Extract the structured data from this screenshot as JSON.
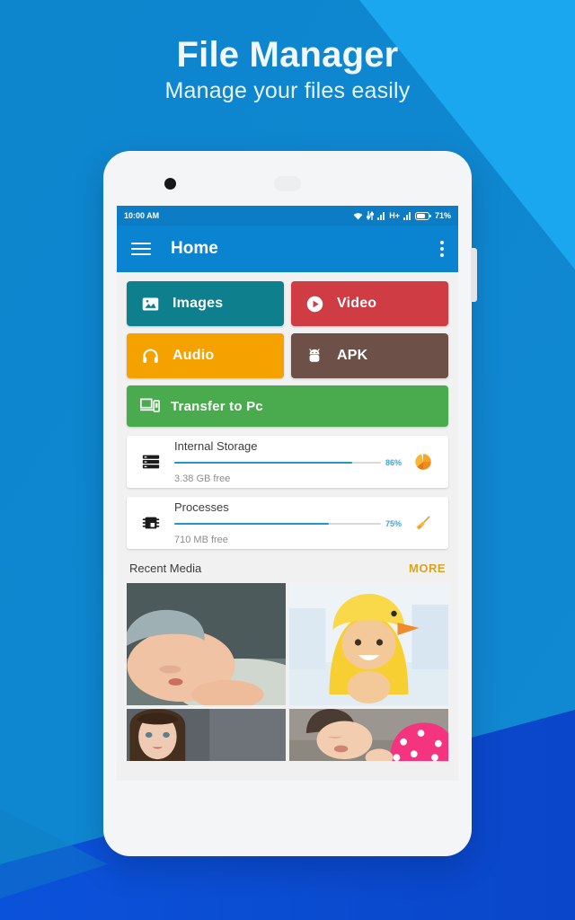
{
  "hero": {
    "title": "File Manager",
    "subtitle": "Manage your files easily"
  },
  "colors": {
    "bg_primary": "#0d85cd",
    "bg_light_wedge": "#1aa7f0",
    "bg_deep_blue": "#0a4ed6",
    "appbar": "#0a84d0",
    "statusbar": "#0c7dc4",
    "accent_more": "#d9a520",
    "progress": "#2196c9"
  },
  "phone": {
    "statusbar": {
      "time": "10:00 AM",
      "battery_percent": "71%",
      "network_type": "H+",
      "icons": [
        "wifi-icon",
        "data-transfer-icon",
        "signal-icon",
        "signal-icon",
        "battery-icon"
      ]
    },
    "appbar": {
      "menu_icon": "hamburger-menu-icon",
      "title": "Home",
      "overflow_icon": "kebab-menu-icon"
    },
    "tiles": [
      {
        "label": "Images",
        "icon": "image-icon",
        "color": "#0e7f8c",
        "wide": false
      },
      {
        "label": "Video",
        "icon": "play-icon",
        "color": "#cf3c43",
        "wide": false
      },
      {
        "label": "Audio",
        "icon": "headphone-icon",
        "color": "#f5a200",
        "wide": false
      },
      {
        "label": "APK",
        "icon": "android-icon",
        "color": "#6d5149",
        "wide": false
      },
      {
        "label": "Transfer to Pc",
        "icon": "devices-icon",
        "color": "#4aab4e",
        "wide": true
      }
    ],
    "cards": [
      {
        "title": "Internal Storage",
        "icon": "server-stack-icon",
        "percent": 86,
        "percent_label": "86%",
        "subtitle": "3.38 GB free",
        "action_icon": "pie-chart-icon"
      },
      {
        "title": "Processes",
        "icon": "cpu-chip-icon",
        "percent": 75,
        "percent_label": "75%",
        "subtitle": "710 MB free",
        "action_icon": "broom-icon"
      }
    ],
    "recent_media": {
      "title": "Recent Media",
      "more_label": "MORE",
      "thumbnails": [
        {
          "name": "sleeping-baby-in-knit-hat",
          "tall": true
        },
        {
          "name": "baby-in-yellow-duck-towel",
          "tall": true
        },
        {
          "name": "woman-portrait",
          "tall": false
        },
        {
          "name": "baby-with-pink-blanket",
          "tall": false
        }
      ]
    }
  }
}
